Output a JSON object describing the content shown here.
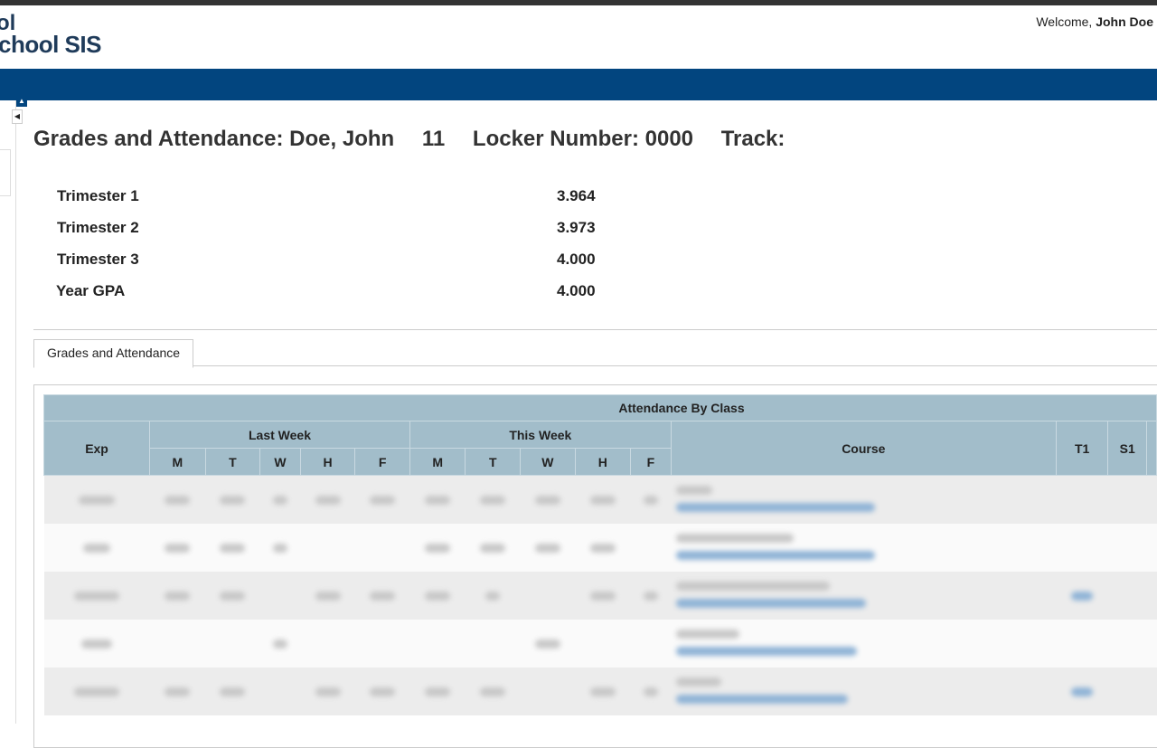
{
  "header": {
    "logo_top": "ol",
    "logo": "chool SIS",
    "welcome_prefix": "Welcome,",
    "user_name": "John Doe"
  },
  "student": {
    "title": "Grades and Attendance: Doe, John",
    "grade": "11",
    "locker": "Locker Number: 0000",
    "track": "Track:"
  },
  "gpa": [
    {
      "label": "Trimester 1",
      "value": "3.964"
    },
    {
      "label": "Trimester 2",
      "value": "3.973"
    },
    {
      "label": "Trimester 3",
      "value": "4.000"
    },
    {
      "label": "Year GPA",
      "value": "4.000"
    }
  ],
  "tabs": {
    "active": "Grades and Attendance"
  },
  "table": {
    "super_header": "Attendance By Class",
    "exp": "Exp",
    "last_week": "Last Week",
    "this_week": "This Week",
    "course": "Course",
    "t1": "T1",
    "s1": "S1",
    "days": [
      "M",
      "T",
      "W",
      "H",
      "F"
    ]
  },
  "colors": {
    "nav": "#02457f",
    "table_header": "#a2bdca",
    "logo_text": "#1f3b5a"
  }
}
